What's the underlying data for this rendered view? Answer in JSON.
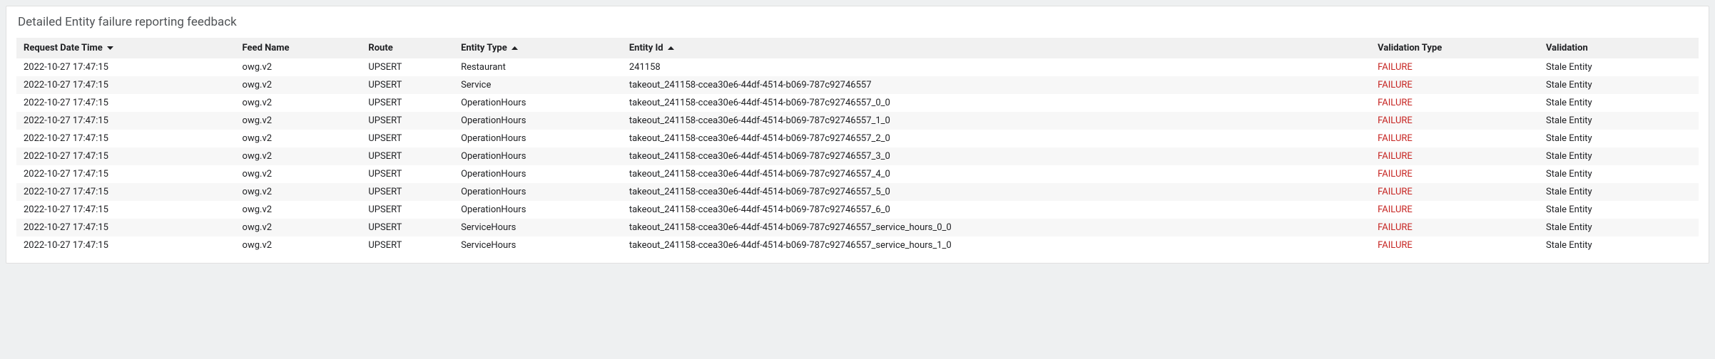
{
  "panel": {
    "title": "Detailed Entity failure reporting feedback"
  },
  "columns": [
    {
      "key": "request_dt",
      "label": "Request Date Time",
      "sort": "desc"
    },
    {
      "key": "feed_name",
      "label": "Feed Name",
      "sort": "none"
    },
    {
      "key": "route",
      "label": "Route",
      "sort": "none"
    },
    {
      "key": "entity_type",
      "label": "Entity Type",
      "sort": "asc"
    },
    {
      "key": "entity_id",
      "label": "Entity Id",
      "sort": "asc"
    },
    {
      "key": "validation_type",
      "label": "Validation Type",
      "sort": "none"
    },
    {
      "key": "validation",
      "label": "Validation",
      "sort": "none"
    }
  ],
  "colors": {
    "failure": "#c5221f"
  },
  "rows": [
    {
      "request_dt": "2022-10-27 17:47:15",
      "feed_name": "owg.v2",
      "route": "UPSERT",
      "entity_type": "Restaurant",
      "entity_id": "241158",
      "validation_type": "FAILURE",
      "validation": "Stale Entity"
    },
    {
      "request_dt": "2022-10-27 17:47:15",
      "feed_name": "owg.v2",
      "route": "UPSERT",
      "entity_type": "Service",
      "entity_id": "takeout_241158-ccea30e6-44df-4514-b069-787c92746557",
      "validation_type": "FAILURE",
      "validation": "Stale Entity"
    },
    {
      "request_dt": "2022-10-27 17:47:15",
      "feed_name": "owg.v2",
      "route": "UPSERT",
      "entity_type": "OperationHours",
      "entity_id": "takeout_241158-ccea30e6-44df-4514-b069-787c92746557_0_0",
      "validation_type": "FAILURE",
      "validation": "Stale Entity"
    },
    {
      "request_dt": "2022-10-27 17:47:15",
      "feed_name": "owg.v2",
      "route": "UPSERT",
      "entity_type": "OperationHours",
      "entity_id": "takeout_241158-ccea30e6-44df-4514-b069-787c92746557_1_0",
      "validation_type": "FAILURE",
      "validation": "Stale Entity"
    },
    {
      "request_dt": "2022-10-27 17:47:15",
      "feed_name": "owg.v2",
      "route": "UPSERT",
      "entity_type": "OperationHours",
      "entity_id": "takeout_241158-ccea30e6-44df-4514-b069-787c92746557_2_0",
      "validation_type": "FAILURE",
      "validation": "Stale Entity"
    },
    {
      "request_dt": "2022-10-27 17:47:15",
      "feed_name": "owg.v2",
      "route": "UPSERT",
      "entity_type": "OperationHours",
      "entity_id": "takeout_241158-ccea30e6-44df-4514-b069-787c92746557_3_0",
      "validation_type": "FAILURE",
      "validation": "Stale Entity"
    },
    {
      "request_dt": "2022-10-27 17:47:15",
      "feed_name": "owg.v2",
      "route": "UPSERT",
      "entity_type": "OperationHours",
      "entity_id": "takeout_241158-ccea30e6-44df-4514-b069-787c92746557_4_0",
      "validation_type": "FAILURE",
      "validation": "Stale Entity"
    },
    {
      "request_dt": "2022-10-27 17:47:15",
      "feed_name": "owg.v2",
      "route": "UPSERT",
      "entity_type": "OperationHours",
      "entity_id": "takeout_241158-ccea30e6-44df-4514-b069-787c92746557_5_0",
      "validation_type": "FAILURE",
      "validation": "Stale Entity"
    },
    {
      "request_dt": "2022-10-27 17:47:15",
      "feed_name": "owg.v2",
      "route": "UPSERT",
      "entity_type": "OperationHours",
      "entity_id": "takeout_241158-ccea30e6-44df-4514-b069-787c92746557_6_0",
      "validation_type": "FAILURE",
      "validation": "Stale Entity"
    },
    {
      "request_dt": "2022-10-27 17:47:15",
      "feed_name": "owg.v2",
      "route": "UPSERT",
      "entity_type": "ServiceHours",
      "entity_id": "takeout_241158-ccea30e6-44df-4514-b069-787c92746557_service_hours_0_0",
      "validation_type": "FAILURE",
      "validation": "Stale Entity"
    },
    {
      "request_dt": "2022-10-27 17:47:15",
      "feed_name": "owg.v2",
      "route": "UPSERT",
      "entity_type": "ServiceHours",
      "entity_id": "takeout_241158-ccea30e6-44df-4514-b069-787c92746557_service_hours_1_0",
      "validation_type": "FAILURE",
      "validation": "Stale Entity"
    }
  ]
}
